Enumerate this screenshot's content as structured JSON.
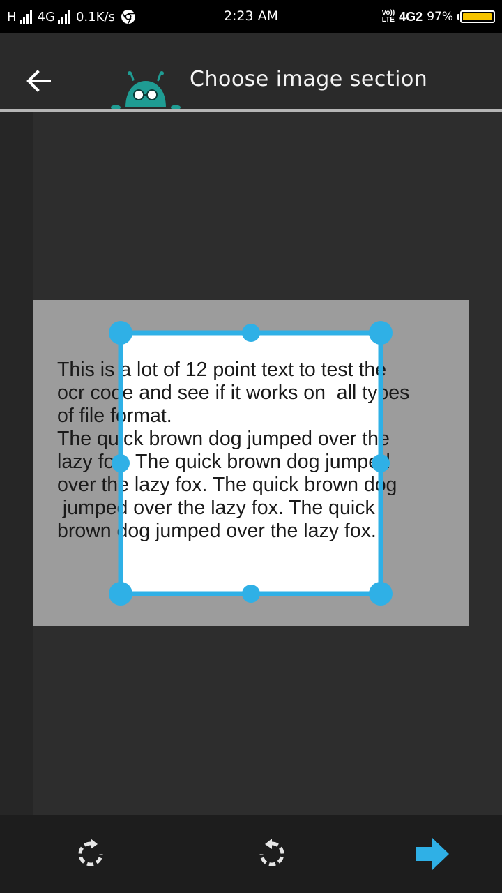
{
  "status_bar": {
    "carrier_left": "H",
    "network_left": "4G",
    "speed": "0.1K/s",
    "time": "2:23 AM",
    "volte_top": "Vo))",
    "volte_bottom": "LTE",
    "network_right": "4G2",
    "battery_percent": "97%",
    "battery_level": 0.97,
    "browser_icon": "chrome-icon",
    "battery_color": "#f6c400"
  },
  "app_bar": {
    "title": "Choose image section",
    "back_icon": "arrow-left-icon",
    "mascot_icon": "robot-mascot-icon",
    "mascot_color": "#1f9c93"
  },
  "document": {
    "lines": [
      "This is a lot of 12 point text to test the",
      "ocr code and see if it works on  all types",
      "of file format.",
      "The quick brown dog jumped over the",
      "lazy fox. The quick brown dog jumped",
      "over the lazy fox. The quick brown dog",
      " jumped over the lazy fox. The quick",
      "brown dog jumped over the lazy fox."
    ]
  },
  "crop": {
    "accent_color": "#2fb0e6",
    "handles": [
      "top-left",
      "top",
      "top-right",
      "left",
      "right",
      "bottom-left",
      "bottom",
      "bottom-right"
    ]
  },
  "toolbar": {
    "rotate_right_icon": "rotate-clockwise-icon",
    "rotate_left_icon": "rotate-counterclockwise-icon",
    "next_icon": "arrow-right-icon",
    "accent_color": "#2fb0e6"
  }
}
